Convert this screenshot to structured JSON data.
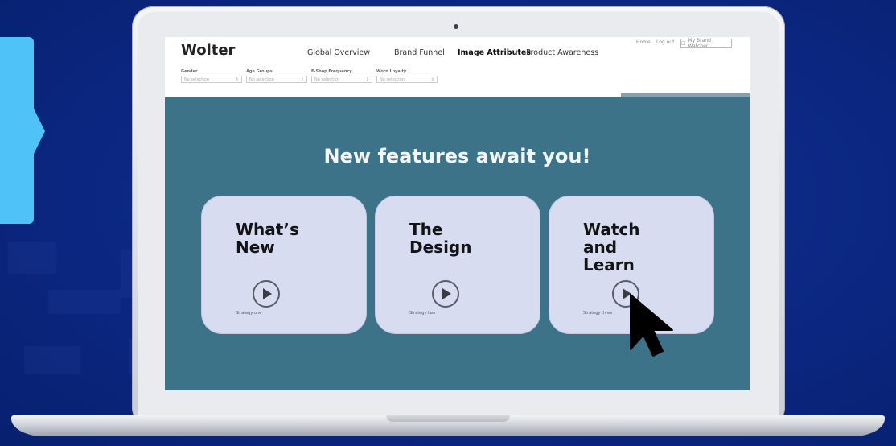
{
  "app": {
    "logo": "Wolter",
    "nav": [
      "Global Overview",
      "Brand Funnel",
      "Image Attributes",
      "Product Awareness"
    ],
    "active_nav": "Image Attributes",
    "top_links": [
      "Home",
      "Log out"
    ],
    "brand_watcher_button": "My Brand Watcher",
    "filters": [
      {
        "label": "Gender",
        "value": "No selection"
      },
      {
        "label": "Age Groups",
        "value": "No selection"
      },
      {
        "label": "E-Shop Frequency",
        "value": "No selection"
      },
      {
        "label": "Worn Loyalty",
        "value": "No selection"
      }
    ]
  },
  "overlay": {
    "headline": "New features await you!",
    "cards": [
      {
        "title": "What’s\nNew",
        "caption": "Strategy one"
      },
      {
        "title": "The\nDesign",
        "caption": "Strategy two"
      },
      {
        "title": "Watch\nand\nLearn",
        "caption": "Strategy three"
      }
    ]
  },
  "colors": {
    "background": "#0b2782",
    "overlay": "#3c7388",
    "card": "#d8dcf0",
    "accent_tab": "#4fc3f7"
  },
  "icons": [
    "play-icon",
    "cursor-icon",
    "chevron-right-icon",
    "user-icon"
  ]
}
